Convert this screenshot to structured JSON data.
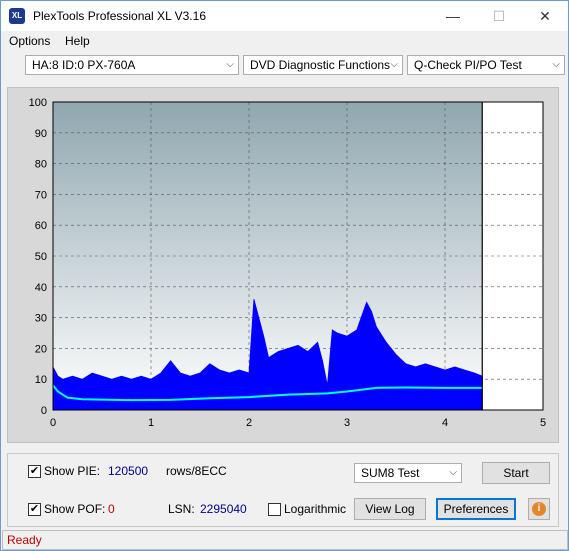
{
  "window": {
    "title": "PlexTools Professional XL V3.16",
    "icon_text": "XL"
  },
  "menu": {
    "options": "Options",
    "help": "Help"
  },
  "combos": {
    "drive": "HA:8 ID:0  PX-760A",
    "functions": "DVD Diagnostic Functions",
    "test": "Q-Check PI/PO Test"
  },
  "chart_data": {
    "type": "area",
    "y_ticks": [
      "100",
      "90",
      "80",
      "70",
      "60",
      "50",
      "40",
      "30",
      "20",
      "10",
      "0"
    ],
    "x_ticks": [
      "0",
      "1",
      "2",
      "3",
      "4",
      "5"
    ],
    "ylim": [
      0,
      100
    ],
    "xlim": [
      0,
      5
    ],
    "grid": true,
    "end_x": 4.38,
    "series": [
      {
        "color": "#0000ff",
        "style": "bars",
        "points": [
          [
            0.0,
            14
          ],
          [
            0.05,
            11
          ],
          [
            0.1,
            10
          ],
          [
            0.2,
            11
          ],
          [
            0.3,
            10
          ],
          [
            0.4,
            12
          ],
          [
            0.5,
            11
          ],
          [
            0.6,
            10
          ],
          [
            0.7,
            11
          ],
          [
            0.8,
            10
          ],
          [
            0.9,
            11
          ],
          [
            1.0,
            10
          ],
          [
            1.1,
            12
          ],
          [
            1.2,
            16
          ],
          [
            1.3,
            12
          ],
          [
            1.4,
            11
          ],
          [
            1.5,
            12
          ],
          [
            1.6,
            15
          ],
          [
            1.7,
            13
          ],
          [
            1.8,
            12
          ],
          [
            1.9,
            13
          ],
          [
            2.0,
            12
          ],
          [
            2.05,
            36
          ],
          [
            2.1,
            30
          ],
          [
            2.15,
            24
          ],
          [
            2.2,
            17
          ],
          [
            2.3,
            19
          ],
          [
            2.4,
            20
          ],
          [
            2.5,
            21
          ],
          [
            2.6,
            19
          ],
          [
            2.7,
            22
          ],
          [
            2.75,
            16
          ],
          [
            2.8,
            8
          ],
          [
            2.85,
            26
          ],
          [
            2.9,
            25
          ],
          [
            3.0,
            24
          ],
          [
            3.1,
            26
          ],
          [
            3.2,
            35
          ],
          [
            3.25,
            32
          ],
          [
            3.3,
            27
          ],
          [
            3.4,
            22
          ],
          [
            3.5,
            18
          ],
          [
            3.6,
            15
          ],
          [
            3.7,
            14
          ],
          [
            3.8,
            15
          ],
          [
            3.9,
            14
          ],
          [
            4.0,
            13
          ],
          [
            4.1,
            14
          ],
          [
            4.2,
            13
          ],
          [
            4.3,
            12
          ],
          [
            4.38,
            11
          ]
        ]
      },
      {
        "color": "#00ffff",
        "style": "line",
        "points": [
          [
            0.0,
            8
          ],
          [
            0.05,
            6
          ],
          [
            0.15,
            4
          ],
          [
            0.3,
            3.5
          ],
          [
            0.8,
            3.2
          ],
          [
            1.2,
            3.3
          ],
          [
            1.6,
            3.8
          ],
          [
            2.0,
            4.2
          ],
          [
            2.4,
            5.0
          ],
          [
            2.8,
            5.4
          ],
          [
            3.0,
            6.0
          ],
          [
            3.3,
            7.2
          ],
          [
            3.6,
            7.3
          ],
          [
            4.0,
            7.2
          ],
          [
            4.38,
            7.2
          ]
        ]
      }
    ]
  },
  "panel": {
    "show_pie_label": "Show PIE:",
    "pie_value": "120500",
    "pie_unit": "rows/8ECC",
    "show_pof_label": "Show POF:",
    "pof_value": "0",
    "lsn_label": "LSN:",
    "lsn_value": "2295040",
    "log_label": "Logarithmic",
    "sum_select": "SUM8 Test",
    "start_btn": "Start",
    "viewlog_btn": "View Log",
    "prefs_btn": "Preferences",
    "pie_checked": "✔",
    "pof_checked": "✔"
  },
  "status": {
    "text": "Ready"
  }
}
